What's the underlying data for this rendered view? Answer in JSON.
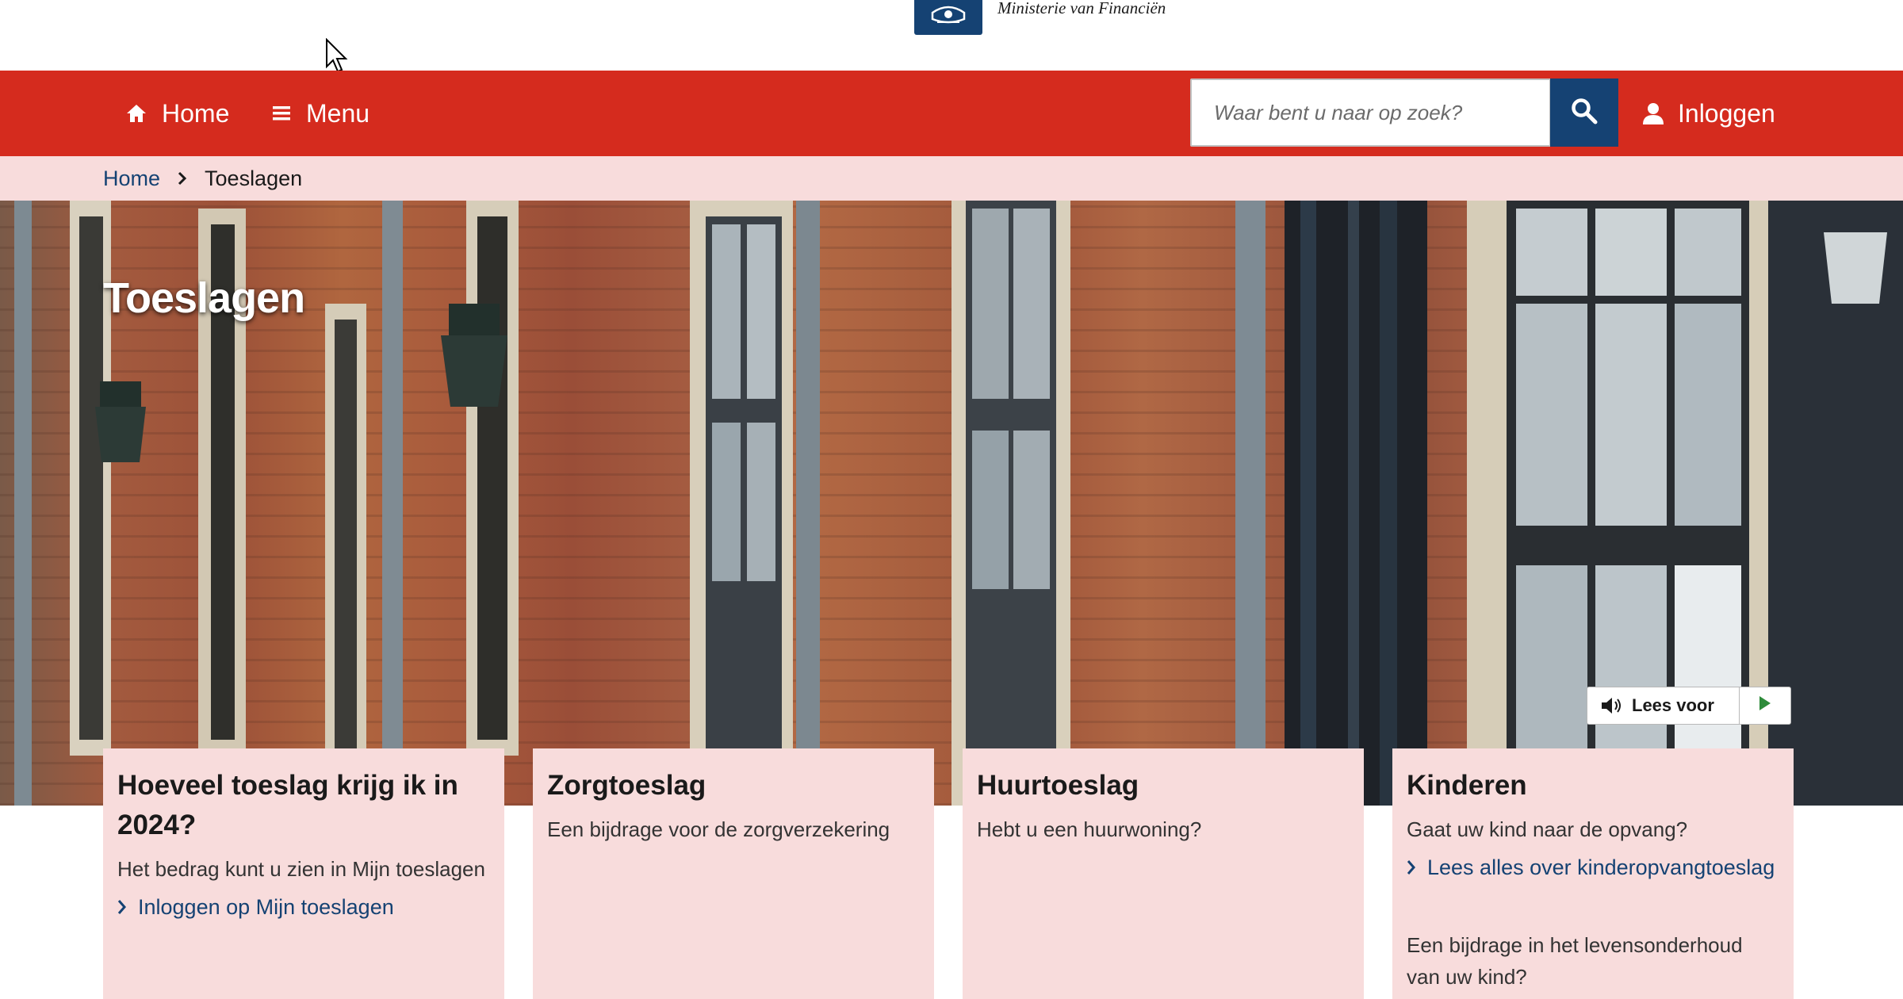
{
  "header": {
    "logo_text": "Ministerie van Financiën",
    "logo_icon": "rijksoverheid-logo"
  },
  "nav": {
    "home_label": "Home",
    "menu_label": "Menu",
    "search_placeholder": "Waar bent u naar op zoek?",
    "search_icon": "search-icon",
    "login_label": "Inloggen"
  },
  "breadcrumb": {
    "items": [
      "Home",
      "Toeslagen"
    ]
  },
  "hero": {
    "title": "Toeslagen",
    "read_aloud_label": "Lees voor"
  },
  "cards": [
    {
      "title": "Hoeveel toeslag krijg ik in 2024?",
      "text": "Het bedrag kunt u zien in Mijn toeslagen",
      "link": "Inloggen op Mijn toeslagen"
    },
    {
      "title": "Zorgtoeslag",
      "text": "Een bijdrage voor de zorgverzekering"
    },
    {
      "title": "Huurtoeslag",
      "text": "Hebt u een huurwoning?"
    },
    {
      "title": "Kinderen",
      "text": "Gaat uw kind naar de opvang?",
      "link": "Lees alles over kinderopvangtoeslag",
      "text2": "Een bijdrage in het levensonderhoud van uw kind?"
    }
  ],
  "colors": {
    "brand_red": "#d52b1e",
    "brand_blue": "#154273",
    "light_pink": "#f8dcdc"
  }
}
